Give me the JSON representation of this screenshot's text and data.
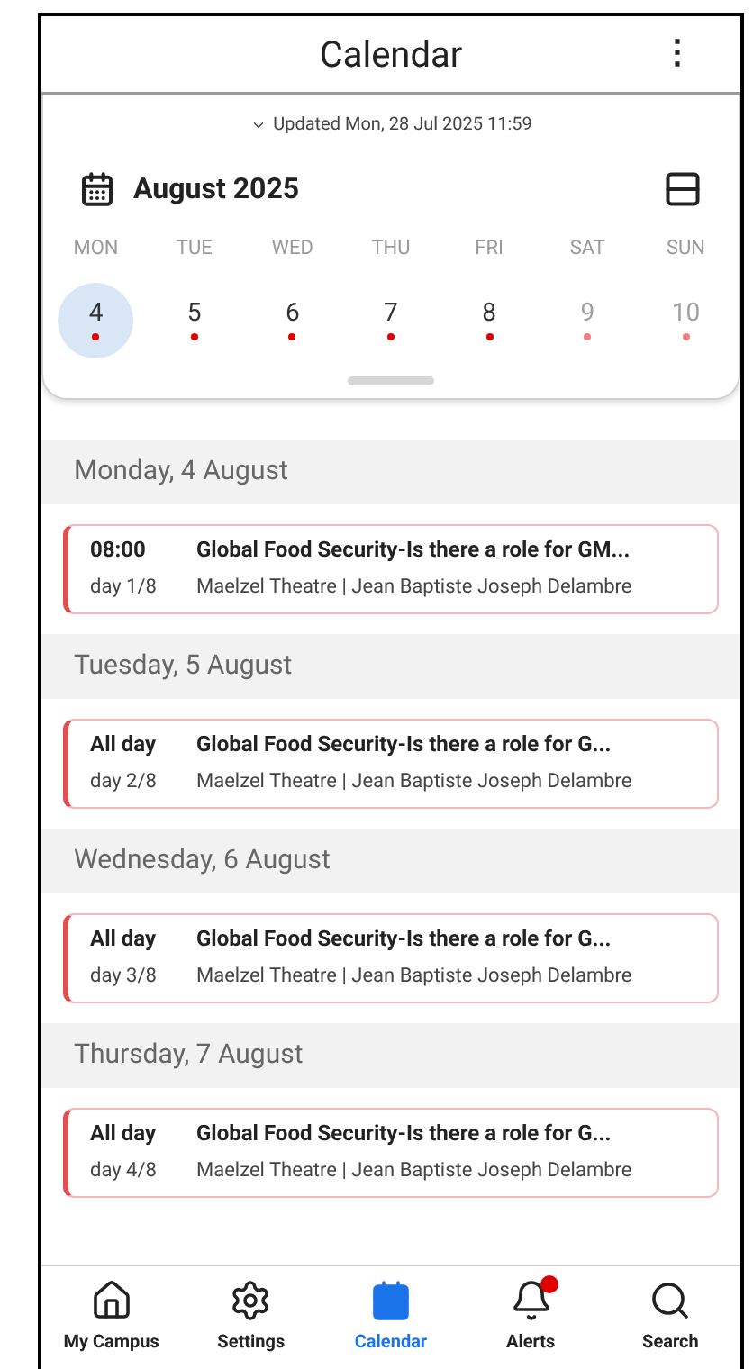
{
  "header": {
    "title": "Calendar",
    "menu_icon": "⋮"
  },
  "updated": {
    "text": "Updated Mon, 28 Jul 2025 11:59",
    "expanded": false
  },
  "month": {
    "label": "August 2025"
  },
  "weekdays": [
    "MON",
    "TUE",
    "WED",
    "THU",
    "FRI",
    "SAT",
    "SUN"
  ],
  "dates": [
    {
      "day": "4",
      "selected": true,
      "muted": false
    },
    {
      "day": "5",
      "selected": false,
      "muted": false
    },
    {
      "day": "6",
      "selected": false,
      "muted": false
    },
    {
      "day": "7",
      "selected": false,
      "muted": false
    },
    {
      "day": "8",
      "selected": false,
      "muted": false
    },
    {
      "day": "9",
      "selected": false,
      "muted": true
    },
    {
      "day": "10",
      "selected": false,
      "muted": true
    }
  ],
  "sections": [
    {
      "heading": "Monday, 4 August",
      "events": [
        {
          "time": "08:00",
          "title": "Global Food Security-Is there a role for GM...",
          "day": "day 1/8",
          "location": "Maelzel Theatre | Jean Baptiste Joseph Delambre"
        }
      ]
    },
    {
      "heading": "Tuesday, 5 August",
      "events": [
        {
          "time": "All day",
          "title": "Global Food Security-Is there a role for G...",
          "day": "day 2/8",
          "location": "Maelzel Theatre | Jean Baptiste Joseph Delambre"
        }
      ]
    },
    {
      "heading": "Wednesday, 6 August",
      "events": [
        {
          "time": "All day",
          "title": "Global Food Security-Is there a role for G...",
          "day": "day 3/8",
          "location": "Maelzel Theatre | Jean Baptiste Joseph Delambre"
        }
      ]
    },
    {
      "heading": "Thursday, 7 August",
      "events": [
        {
          "time": "All day",
          "title": "Global Food Security-Is there a role for G...",
          "day": "day 4/8",
          "location": "Maelzel Theatre | Jean Baptiste Joseph Delambre"
        }
      ]
    }
  ],
  "nav": [
    {
      "kind": "home",
      "label": "My Campus",
      "selected": false,
      "badge": false
    },
    {
      "kind": "settings",
      "label": "Settings",
      "selected": false,
      "badge": false
    },
    {
      "kind": "calendar",
      "label": "Calendar",
      "selected": true,
      "badge": false
    },
    {
      "kind": "alerts",
      "label": "Alerts",
      "selected": false,
      "badge": true
    },
    {
      "kind": "search",
      "label": "Search",
      "selected": false,
      "badge": false
    }
  ]
}
